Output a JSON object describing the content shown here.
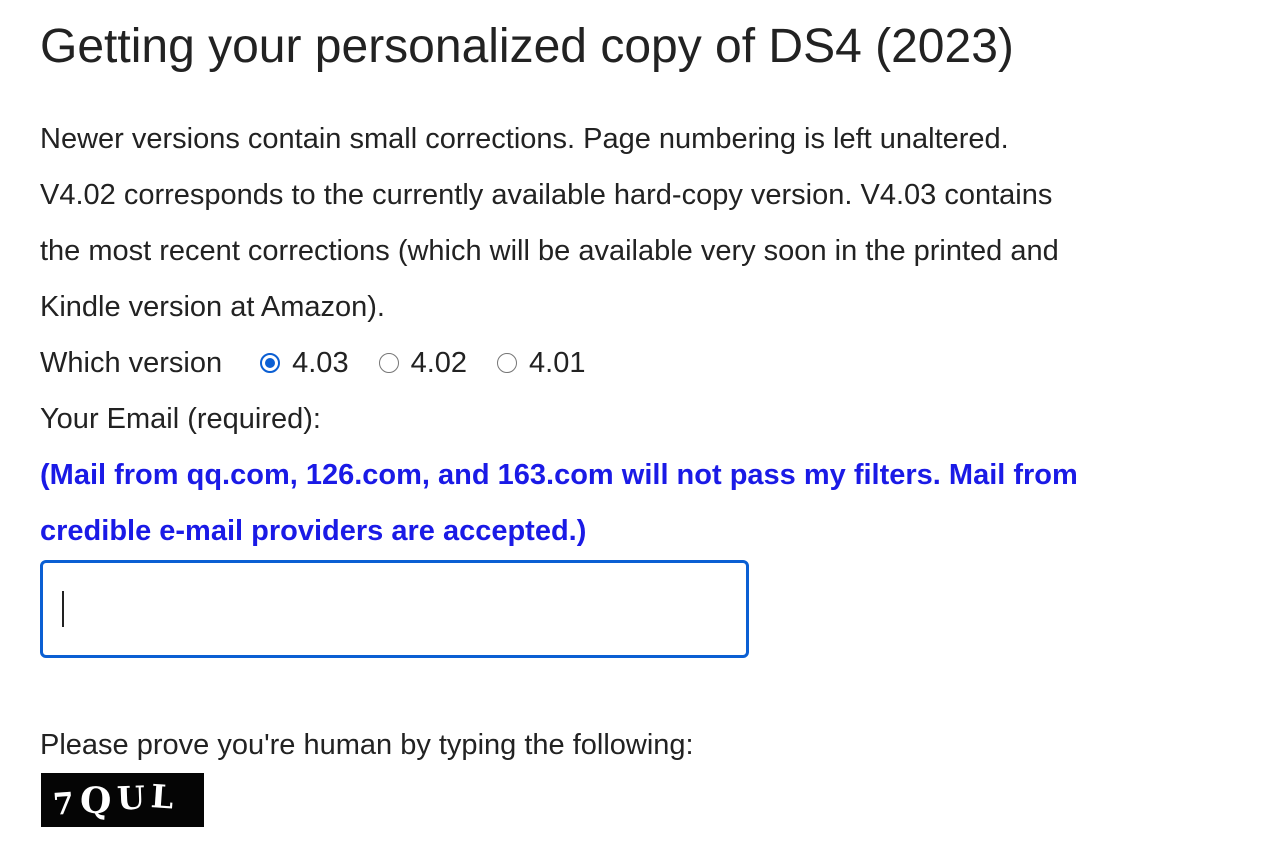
{
  "title": "Getting your personalized copy of DS4 (2023)",
  "description": {
    "lines": [
      "Newer versions contain small corrections. Page numbering is left unaltered.",
      "V4.02 corresponds to the currently available hard-copy version. V4.03 contains",
      "the most recent corrections (which will be available very soon in the printed and",
      "Kindle version at Amazon)."
    ]
  },
  "version": {
    "label": "Which version",
    "options": [
      {
        "label": "4.03",
        "checked": true
      },
      {
        "label": "4.02",
        "checked": false
      },
      {
        "label": "4.01",
        "checked": false
      }
    ],
    "accent_color": "#0b5fd3"
  },
  "email": {
    "label": "Your Email (required):",
    "notice": "(Mail from qq.com, 126.com, and 163.com will not pass my filters. Mail from credible e-mail providers are accepted.)",
    "notice_color": "#1a1ae6",
    "value": "",
    "placeholder": ""
  },
  "captcha": {
    "prompt": "Please prove you're human by typing the following:",
    "characters": [
      "7",
      "Q",
      "U",
      "L"
    ]
  }
}
